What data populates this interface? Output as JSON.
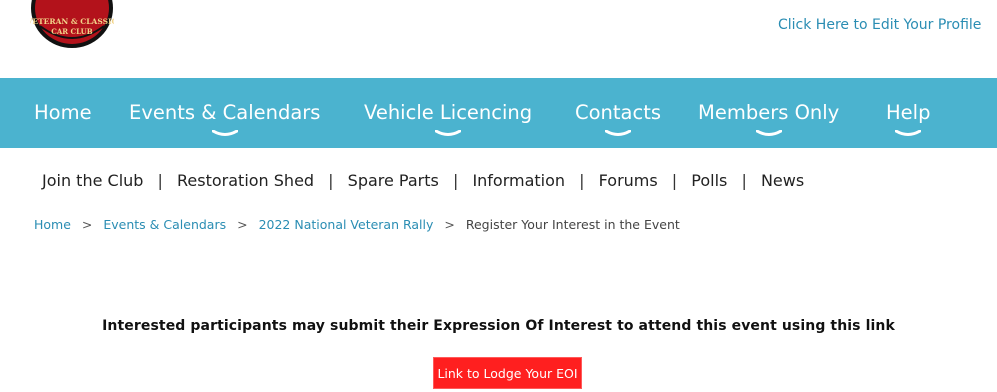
{
  "header": {
    "logo_text": [
      "VETERAN & CLASSIC",
      "CAR CLUB"
    ],
    "profile_link": "Click Here to Edit Your Profile"
  },
  "main_nav": {
    "background": "#4bb3cf",
    "items": [
      {
        "label": "Home",
        "has_dropdown": false
      },
      {
        "label": "Events & Calendars",
        "has_dropdown": true
      },
      {
        "label": "Vehicle Licencing",
        "has_dropdown": true
      },
      {
        "label": "Contacts",
        "has_dropdown": true
      },
      {
        "label": "Members Only",
        "has_dropdown": true
      },
      {
        "label": "Help",
        "has_dropdown": true
      }
    ]
  },
  "sub_nav": {
    "items": [
      "Join the Club",
      "Restoration Shed",
      "Spare Parts",
      "Information",
      "Forums",
      "Polls",
      "News"
    ],
    "separator": "|"
  },
  "breadcrumb": {
    "items": [
      "Home",
      "Events & Calendars",
      "2022 National Veteran Rally",
      "Register Your Interest in the Event"
    ],
    "separator": ">"
  },
  "content": {
    "eoi_text": "Interested participants may submit their Expression Of Interest to attend this event using this link",
    "eoi_button": "Link to Lodge Your EOI",
    "button_color": "#ff1f1f",
    "link_color": "#2a8db3"
  }
}
